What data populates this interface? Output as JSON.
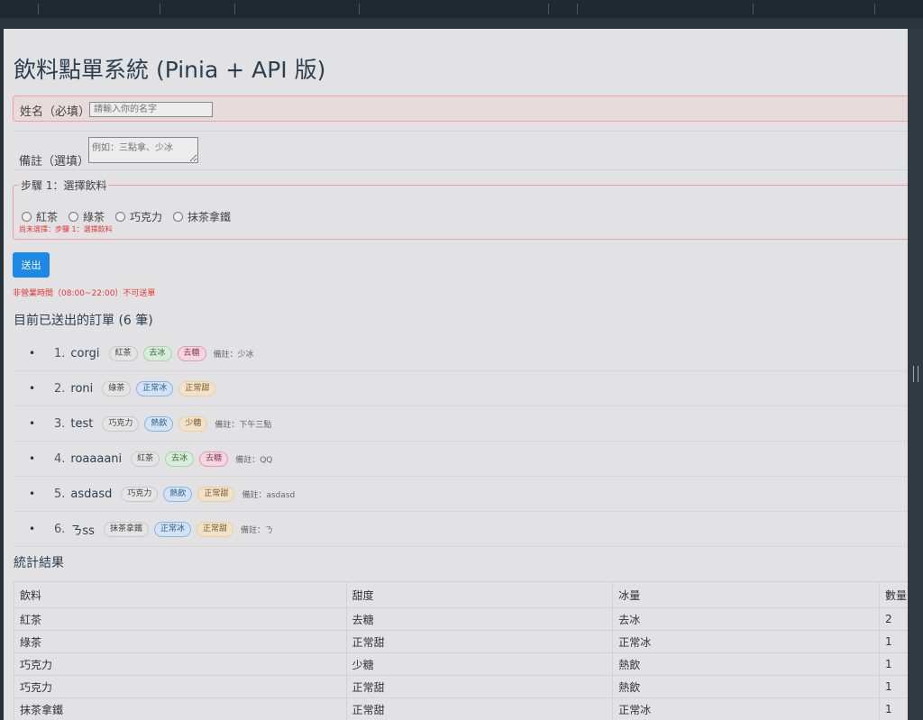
{
  "app": {
    "title": "飲料點單系統 (Pinia + API 版)"
  },
  "form": {
    "name_label": "姓名（必填）",
    "name_placeholder": "請輸入你的名字",
    "note_label": "備註（選填）",
    "note_placeholder": "例如：三點拿、少冰",
    "step1_legend": "步驟 1：選擇飲料",
    "drinks": [
      "紅茶",
      "綠茶",
      "巧克力",
      "抹茶拿鐵"
    ],
    "step1_error": "尚未選擇：步驟 1：選擇飲料",
    "submit_label": "送出",
    "hours_warning": "非營業時間（08:00~22:00）不可送單"
  },
  "orders": {
    "title": "目前已送出的訂單 (6 筆)",
    "bullet": "•",
    "items": [
      {
        "index": "1.",
        "name": "corgi",
        "drink": "紅茶",
        "ice": "去冰",
        "sugar": "去糖",
        "remark": "備註：少冰"
      },
      {
        "index": "2.",
        "name": "roni",
        "drink": "綠茶",
        "ice": "正常冰",
        "sugar": "正常甜",
        "remark": ""
      },
      {
        "index": "3.",
        "name": "test",
        "drink": "巧克力",
        "ice": "熱飲",
        "sugar": "少糖",
        "remark": "備註：下午三點"
      },
      {
        "index": "4.",
        "name": "roaaaani",
        "drink": "紅茶",
        "ice": "去冰",
        "sugar": "去糖",
        "remark": "備註：QQ"
      },
      {
        "index": "5.",
        "name": "asdasd",
        "drink": "巧克力",
        "ice": "熱飲",
        "sugar": "正常甜",
        "remark": "備註：asdasd"
      },
      {
        "index": "6.",
        "name": "ㄋss",
        "drink": "抹茶拿鐵",
        "ice": "正常冰",
        "sugar": "正常甜",
        "remark": "備註：ㄋ"
      }
    ]
  },
  "stats": {
    "title": "統計結果",
    "headers": [
      "飲料",
      "甜度",
      "冰量",
      "數量"
    ],
    "rows": [
      [
        "紅茶",
        "去糖",
        "去冰",
        "2"
      ],
      [
        "綠茶",
        "正常甜",
        "正常冰",
        "1"
      ],
      [
        "巧克力",
        "少糖",
        "熱飲",
        "1"
      ],
      [
        "巧克力",
        "正常甜",
        "熱飲",
        "1"
      ],
      [
        "抹茶拿鐵",
        "正常甜",
        "正常冰",
        "1"
      ]
    ]
  },
  "colors": {
    "accent": "#1e88e5",
    "error": "#e53935",
    "heading": "#2c3e50"
  }
}
